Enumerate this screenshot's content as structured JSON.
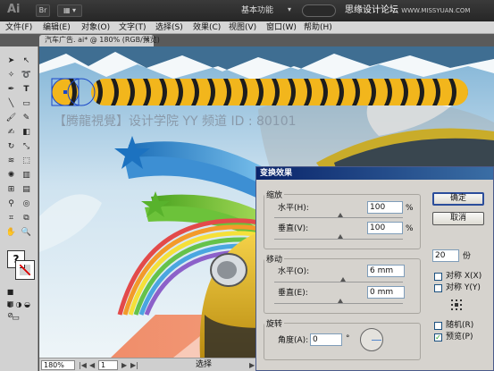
{
  "app": {
    "logo": "Ai",
    "workspace": "基本功能",
    "watermark_site": "思缘设计论坛",
    "watermark_url": "WWW.MISSYUAN.COM"
  },
  "menu": [
    "文件(F)",
    "编辑(E)",
    "对象(O)",
    "文字(T)",
    "选择(S)",
    "效果(C)",
    "视图(V)",
    "窗口(W)",
    "帮助(H)"
  ],
  "document": {
    "tab_title": "汽车广告. ai* @ 180% (RGB/预览)",
    "canvas_watermark": "【腾龍視覺】设计学院  YY 频道 ID : 80101"
  },
  "status": {
    "zoom": "180%",
    "page": "1",
    "tool": "选择"
  },
  "dialog": {
    "title": "变换效果",
    "scale": {
      "legend": "缩放",
      "horizontal_label": "水平(H):",
      "horizontal_value": "100",
      "horizontal_unit": "%",
      "vertical_label": "垂直(V):",
      "vertical_value": "100",
      "vertical_unit": "%"
    },
    "move": {
      "legend": "移动",
      "horizontal_label": "水平(O):",
      "horizontal_value": "6 mm",
      "vertical_label": "垂直(E):",
      "vertical_value": "0 mm"
    },
    "rotate": {
      "legend": "旋转",
      "angle_label": "角度(A):",
      "angle_value": "0",
      "angle_unit": "°"
    },
    "ok_label": "确定",
    "cancel_label": "取消",
    "copies_value": "20",
    "copies_unit": "份",
    "reflect_x_label": "对称 X(X)",
    "reflect_y_label": "对称 Y(Y)",
    "random_label": "随机(R)",
    "preview_label": "预览(P)",
    "preview_checked": true,
    "reflect_x_checked": false,
    "reflect_y_checked": false,
    "random_checked": false
  },
  "colors": {
    "chain_yellow": "#f2b61c",
    "chain_dark": "#1d1d1d",
    "dialog_title": "#0a246a",
    "sky": "#cfe3f0"
  }
}
